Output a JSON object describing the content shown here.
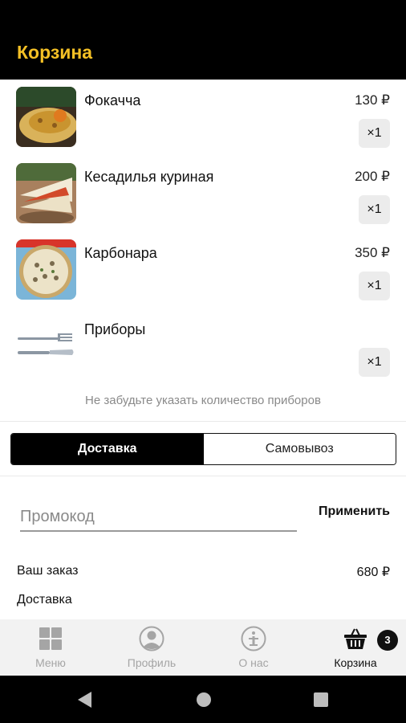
{
  "header": {
    "title": "Корзина"
  },
  "items": [
    {
      "name": "Фокачча",
      "price": "130 ₽",
      "qty": "×1"
    },
    {
      "name": "Кесадилья куриная",
      "price": "200 ₽",
      "qty": "×1"
    },
    {
      "name": "Карбонара",
      "price": "350 ₽",
      "qty": "×1"
    },
    {
      "name": "Приборы",
      "price": "",
      "qty": "×1"
    }
  ],
  "hint": "Не забудьте указать количество приборов",
  "delivery_options": {
    "delivery": "Доставка",
    "pickup": "Самовывоз",
    "selected": "delivery"
  },
  "promo": {
    "placeholder": "Промокод",
    "apply_label": "Применить"
  },
  "summary": {
    "order_label": "Ваш заказ",
    "order_value": "680 ₽",
    "delivery_label": "Доставка"
  },
  "tabbar": {
    "menu": "Меню",
    "profile": "Профиль",
    "about": "О нас",
    "cart": "Корзина",
    "cart_badge": "3"
  },
  "colors": {
    "accent": "#f4c025",
    "header_bg": "#000000"
  },
  "icons": {
    "menu": "grid-icon",
    "profile": "user-icon",
    "about": "info-icon",
    "cart": "basket-icon",
    "nav_back": "back-triangle-icon",
    "nav_home": "home-circle-icon",
    "nav_recents": "recents-square-icon"
  }
}
